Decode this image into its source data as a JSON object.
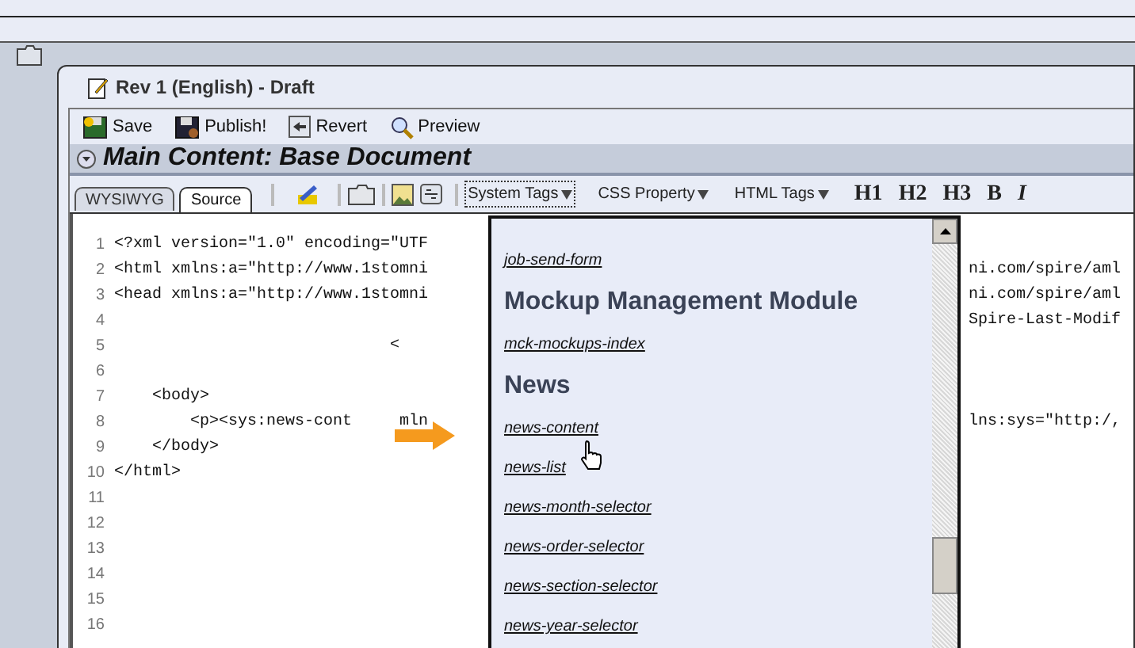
{
  "window": {
    "title": "Rev 1 (English) - Draft"
  },
  "toolbar": [
    {
      "label": "Save",
      "kind": "save"
    },
    {
      "label": "Publish!",
      "kind": "publish"
    },
    {
      "label": "Revert",
      "kind": "revert"
    },
    {
      "label": "Preview",
      "kind": "preview"
    }
  ],
  "section": {
    "title": "Main Content: Base Document"
  },
  "tabs": [
    {
      "label": "WYSIWYG",
      "selected": false
    },
    {
      "label": "Source",
      "selected": true
    }
  ],
  "menus": [
    {
      "label": "System Tags",
      "selected": true
    },
    {
      "label": "CSS Property",
      "selected": false
    },
    {
      "label": "HTML Tags",
      "selected": false
    }
  ],
  "format_buttons": [
    "H1",
    "H2",
    "H3",
    "B",
    "I"
  ],
  "code_lines": [
    {
      "number": "1",
      "left": "<?xml version=\"1.0\" encoding=\"UTF"
    },
    {
      "number": "2",
      "left": "<html xmlns:a=\"http://www.1stomni",
      "right": "ni.com/spire/aml"
    },
    {
      "number": "3",
      "left": "<head xmlns:a=\"http://www.1stomni",
      "right": "ni.com/spire/aml"
    },
    {
      "number": "4",
      "right": "Spire-Last-Modif"
    },
    {
      "number": "5",
      "left": "                             <"
    },
    {
      "number": "6"
    },
    {
      "number": "7",
      "left": "    <body>"
    },
    {
      "number": "8",
      "left": "        <p><sys:news-cont     mln",
      "right": "lns:sys=\"http:/,"
    },
    {
      "number": "9",
      "left": "    </body>"
    },
    {
      "number": "10",
      "left": "</html>"
    },
    {
      "number": "11"
    },
    {
      "number": "12"
    },
    {
      "number": "13"
    },
    {
      "number": "14"
    },
    {
      "number": "15"
    },
    {
      "number": "16"
    }
  ],
  "dropdown": {
    "items": [
      {
        "kind": "link",
        "label": "job-send-form"
      },
      {
        "kind": "heading",
        "label": "Mockup Management Module"
      },
      {
        "kind": "link",
        "label": "mck-mockups-index"
      },
      {
        "kind": "heading",
        "label": "News"
      },
      {
        "kind": "link",
        "label": "news-content"
      },
      {
        "kind": "link",
        "label": "news-list"
      },
      {
        "kind": "link",
        "label": "news-month-selector"
      },
      {
        "kind": "link",
        "label": "news-order-selector"
      },
      {
        "kind": "link",
        "label": "news-section-selector"
      },
      {
        "kind": "link",
        "label": "news-year-selector"
      }
    ]
  }
}
